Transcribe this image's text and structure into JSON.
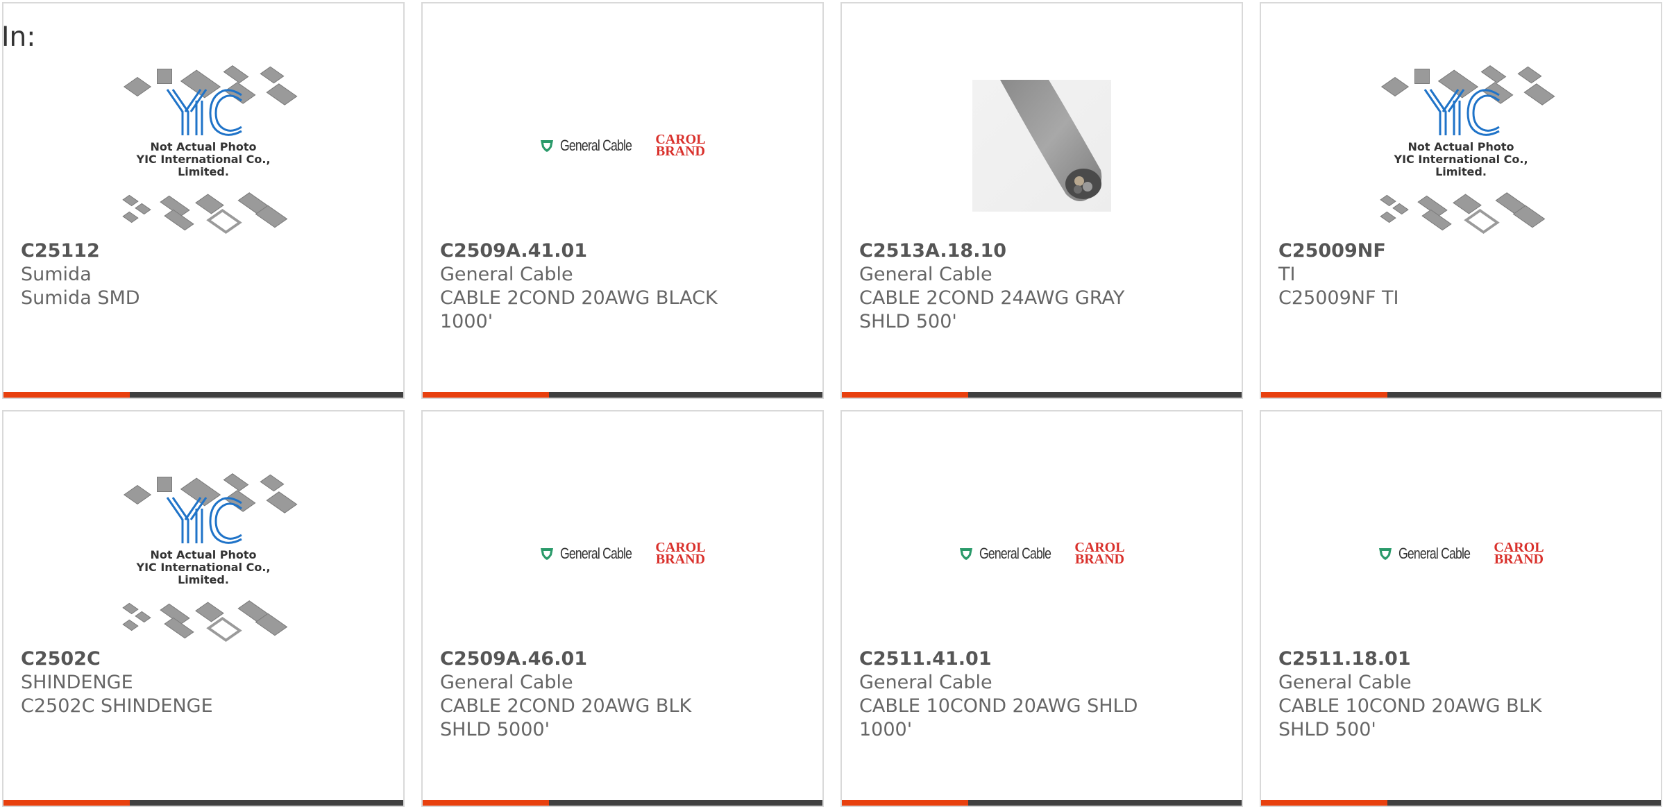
{
  "query_prefix": "In:",
  "colors": {
    "accent": "#e8400e",
    "bar": "#404040",
    "card_border": "#d9d9d9",
    "carol_red": "#d9302b",
    "general_cable_green": "#2a9a6a",
    "yic_blue": "#1f73c8"
  },
  "placeholder": {
    "line1": "Not Actual Photo",
    "line2": "YIC International Co., Limited."
  },
  "logo": {
    "general_cable": "General Cable",
    "carol_line1": "CAROL",
    "carol_line2": "BRAND"
  },
  "products": [
    {
      "part": "C25112",
      "maker": "Sumida",
      "desc": "Sumida SMD",
      "image": "yic-placeholder"
    },
    {
      "part": "C2509A.41.01",
      "maker": "General Cable",
      "desc": "CABLE 2COND 20AWG BLACK 1000'",
      "image": "general-cable-logo"
    },
    {
      "part": "C2513A.18.10",
      "maker": "General Cable",
      "desc": "CABLE 2COND 24AWG GRAY SHLD 500'",
      "image": "cable-photo"
    },
    {
      "part": "C25009NF",
      "maker": "TI",
      "desc": "C25009NF TI",
      "image": "yic-placeholder"
    },
    {
      "part": "C2502C",
      "maker": "SHINDENGE",
      "desc": "C2502C SHINDENGE",
      "image": "yic-placeholder"
    },
    {
      "part": "C2509A.46.01",
      "maker": "General Cable",
      "desc": "CABLE 2COND 20AWG BLK SHLD 5000'",
      "image": "general-cable-logo"
    },
    {
      "part": "C2511.41.01",
      "maker": "General Cable",
      "desc": "CABLE 10COND 20AWG SHLD 1000'",
      "image": "general-cable-logo"
    },
    {
      "part": "C2511.18.01",
      "maker": "General Cable",
      "desc": "CABLE 10COND 20AWG BLK SHLD 500'",
      "image": "general-cable-logo"
    }
  ]
}
